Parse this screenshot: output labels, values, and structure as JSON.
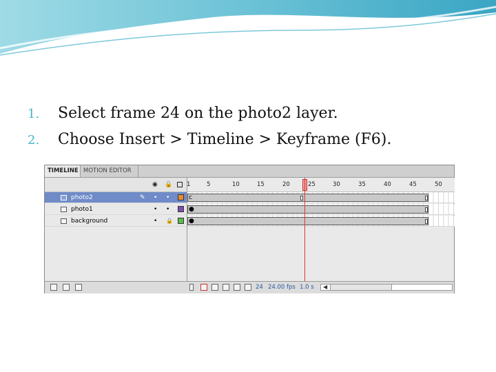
{
  "steps": [
    {
      "num": "1.",
      "text": "Select frame 24 on the photo2 layer."
    },
    {
      "num": "2.",
      "text": "Choose Insert > Timeline > Keyframe (F6)."
    }
  ],
  "timeline": {
    "tabs": [
      "TIMELINE",
      "MOTION EDITOR"
    ],
    "header_icons": {
      "visibility": "eye-icon",
      "lock": "lock-icon",
      "outline": "outline-icon"
    },
    "ruler_numbers": [
      "1",
      "5",
      "10",
      "15",
      "20",
      "25",
      "30",
      "35",
      "40",
      "45",
      "50"
    ],
    "layers": [
      {
        "name": "photo2",
        "selected": true,
        "color": "#e88a2e",
        "first_frame_label": "c"
      },
      {
        "name": "photo1",
        "selected": false,
        "color": "#7a4fb0",
        "first_frame_label": ""
      },
      {
        "name": "background",
        "selected": false,
        "color": "#5cba4f",
        "first_frame_label": ""
      }
    ],
    "current_frame": 24,
    "frame_rate": "24.00 fps",
    "elapsed": "1.0 s"
  }
}
